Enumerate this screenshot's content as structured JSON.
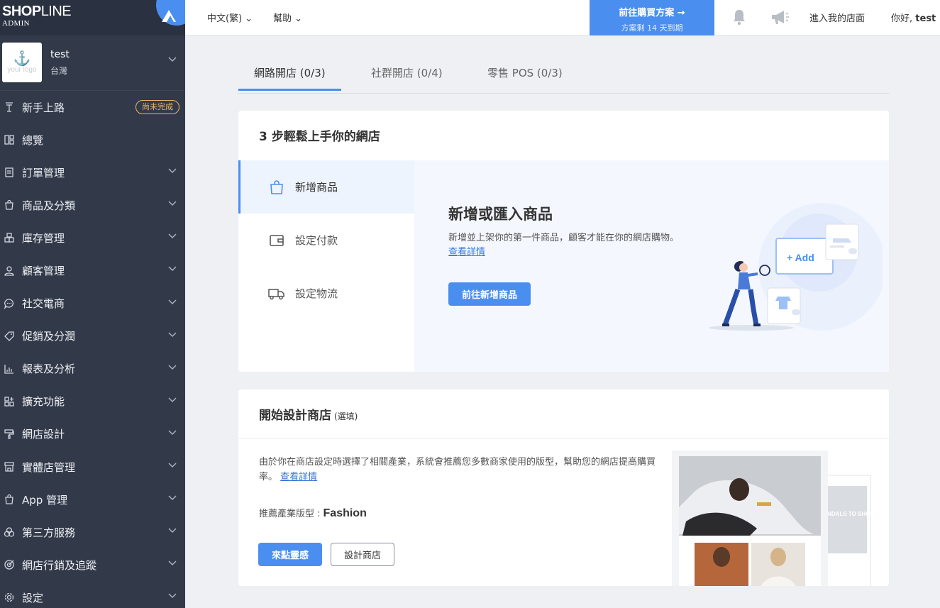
{
  "brand": {
    "logo_bold": "SHOP",
    "logo_thin": "LINE",
    "sub": "ADMIN"
  },
  "store": {
    "avatar_text": "your logo",
    "name": "test",
    "region": "台灣"
  },
  "nav": [
    {
      "label": "新手上路",
      "icon": "flag-icon",
      "badge": "尚未完成"
    },
    {
      "label": "總覽",
      "icon": "dashboard-icon"
    },
    {
      "label": "訂單管理",
      "icon": "order-icon"
    },
    {
      "label": "商品及分類",
      "icon": "bag-icon"
    },
    {
      "label": "庫存管理",
      "icon": "inventory-icon"
    },
    {
      "label": "顧客管理",
      "icon": "user-icon"
    },
    {
      "label": "社交電商",
      "icon": "chat-icon"
    },
    {
      "label": "促銷及分潤",
      "icon": "tag-icon"
    },
    {
      "label": "報表及分析",
      "icon": "chart-icon"
    },
    {
      "label": "擴充功能",
      "icon": "apps-icon"
    },
    {
      "label": "網店設計",
      "icon": "paint-roller-icon"
    },
    {
      "label": "實體店管理",
      "icon": "store-icon"
    },
    {
      "label": "App 管理",
      "icon": "app-bag-icon"
    },
    {
      "label": "第三方服務",
      "icon": "circles-icon"
    },
    {
      "label": "網店行銷及追蹤",
      "icon": "target-icon"
    },
    {
      "label": "設定",
      "icon": "gear-icon"
    }
  ],
  "topbar": {
    "lang": "中文(繁)",
    "help": "幫助",
    "cta_line1": "前往購買方案 →",
    "cta_line2": "方案剩 14 天到期",
    "visit": "進入我的店面",
    "greet": "你好,",
    "user": "test"
  },
  "tabs": [
    {
      "label": "網路開店 (0/3)",
      "active": true
    },
    {
      "label": "社群開店 (0/4)",
      "active": false
    },
    {
      "label": "零售 POS (0/3)",
      "active": false
    }
  ],
  "setup": {
    "title": "3 步輕鬆上手你的網店",
    "steps": [
      {
        "label": "新增商品",
        "icon": "bag-icon"
      },
      {
        "label": "設定付款",
        "icon": "wallet-icon"
      },
      {
        "label": "設定物流",
        "icon": "truck-icon"
      }
    ],
    "panel_title": "新增或匯入商品",
    "panel_desc": "新增並上架你的第一件商品，顧客才能在你的網店購物。",
    "panel_link": "查看詳情",
    "panel_button": "前往新增商品",
    "illus_add": "+ Add"
  },
  "design": {
    "title": "開始設計商店",
    "optional": "(選填)",
    "desc": "由於你在商店設定時選擇了相關產業，系統會推薦您多數商家使用的版型，幫助您的網店提高購買率。",
    "link": "查看詳情",
    "rec_label": "推薦產業版型 :",
    "rec_value": "Fashion",
    "inspire_button": "來點靈感",
    "design_button": "設計商店",
    "preview_text": "SANDALS TO SHOW"
  },
  "colors": {
    "accent": "#4a8ef0",
    "sidebar": "#323a4a",
    "badge": "#f0b567"
  }
}
